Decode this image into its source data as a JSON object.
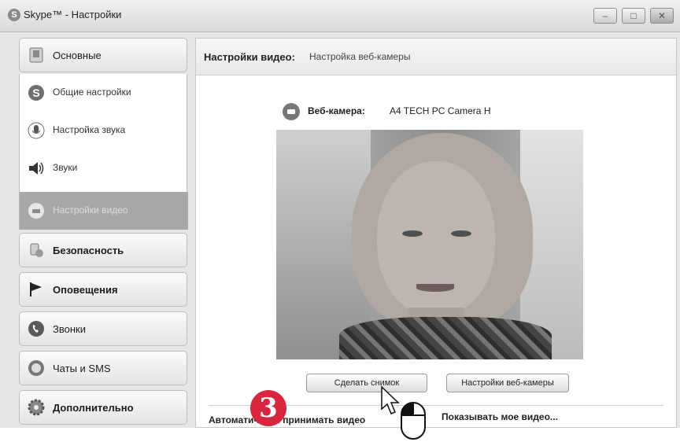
{
  "window": {
    "title": "Skype™ - Настройки",
    "controls": {
      "minimize": "–",
      "maximize": "□",
      "close": "✕"
    }
  },
  "sidebar": {
    "main_category": "Основные",
    "sub_items": [
      {
        "label": "Общие настройки",
        "icon": "skype-icon",
        "active": false
      },
      {
        "label": "Настройка звука",
        "icon": "microphone-icon",
        "active": false
      },
      {
        "label": "Звуки",
        "icon": "speaker-icon",
        "active": false
      },
      {
        "label": "Настройки видео",
        "icon": "webcam-icon",
        "active": true
      }
    ],
    "categories": [
      {
        "label": "Безопасность",
        "icon": "security-icon"
      },
      {
        "label": "Оповещения",
        "icon": "flag-icon"
      },
      {
        "label": "Звонки",
        "icon": "phone-icon"
      },
      {
        "label": "Чаты и SMS",
        "icon": "chat-icon"
      },
      {
        "label": "Дополнительно",
        "icon": "gear-icon"
      }
    ]
  },
  "content": {
    "header_title": "Настройки видео:",
    "header_subtitle": "Настройка веб-камеры",
    "webcam_label": "Веб-камера:",
    "webcam_value": "A4 TECH PC Camera H",
    "snapshot_button": "Сделать снимок",
    "webcam_settings_button": "Настройки веб-камеры",
    "auto_accept_text": "Автоматически принимать видео",
    "show_my_video_text": "Показывать мое видео..."
  },
  "annotation": {
    "step_number": "3"
  }
}
